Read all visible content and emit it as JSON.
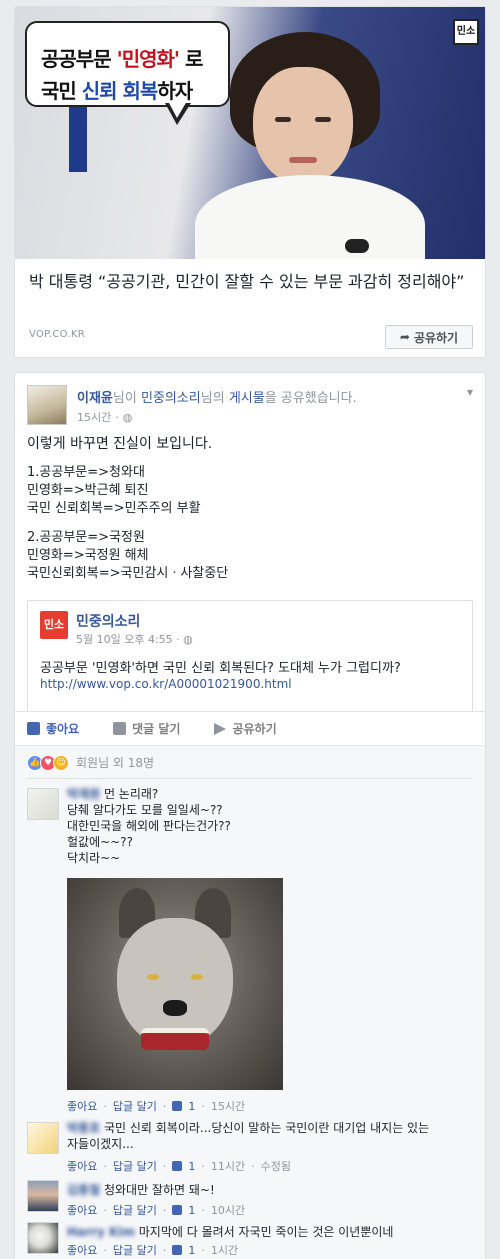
{
  "link_preview": {
    "image": {
      "bubble_line1_pre": "공공부문 ",
      "bubble_line1_hl": "'민영화'",
      "bubble_line1_post": " 로",
      "bubble_line2_pre": "국민 ",
      "bubble_line2_hl": "신뢰 회복",
      "bubble_line2_post": "하자",
      "logo_text": "민소"
    },
    "title": "박 대통령 “공공기관, 민간이 잘할 수 있는 부문 과감히 정리해야”",
    "domain": "VOP.CO.KR",
    "share_label": "공유하기"
  },
  "post": {
    "author": "이재윤",
    "header_mid1": "님이 ",
    "shared_page": "민중의소리",
    "header_mid2": "님의 ",
    "shared_object": "게시물",
    "header_tail": "을 공유했습니다.",
    "time": "15시간",
    "lines": [
      "이렇게 바꾸면 진실이 보입니다.",
      "1.공공부문=>청와대",
      "민영화=>박근혜 퇴진",
      "국민 신뢰회복=>민주주의 부활",
      "2.공공부문=>국정원",
      "민영화=>국정원 해체",
      "국민신뢰회복=>국민감시ㆍ사찰중단"
    ],
    "embed": {
      "logo_text": "민소",
      "page_name": "민중의소리",
      "meta": "5월 10일 오후 4:55",
      "text": "공공부문 '민영화'하면 국민 신뢰 회복된다? 도대체 누가 그럽디까?",
      "url": "http://www.vop.co.kr/A00001021900.html"
    },
    "actions": {
      "like": "좋아요",
      "comment": "댓글 달기",
      "share": "공유하기"
    },
    "reactions_text": "회원님 외 18명"
  },
  "comments": [
    {
      "name": "박재원",
      "lines": [
        "먼 논리래?",
        "당췌 알다가도 모를 일일세~??",
        "대한민국을 해외에 판다는건가??",
        "헐값에~~??",
        "닥치라~~"
      ],
      "like": "좋아요",
      "reply": "답글 달기",
      "likes": "1",
      "time": "15시간",
      "extra": ""
    },
    {
      "name": "박종호",
      "lines": [
        "국민 신뢰 회복이라...당신이 말하는 국민이란 대기업 내지는 있는",
        "자들이겠지..."
      ],
      "like": "좋아요",
      "reply": "답글 달기",
      "likes": "1",
      "time": "11시간",
      "extra": "수정됨"
    },
    {
      "name": "김종철",
      "lines": [
        "청와대만 잘하면 돼~!"
      ],
      "like": "좋아요",
      "reply": "답글 달기",
      "likes": "1",
      "time": "10시간",
      "extra": ""
    },
    {
      "name": "Harry Kim",
      "lines": [
        "마지막에 다 몰려서 자국민 죽이는 것은 이년뿐이네"
      ],
      "like": "좋아요",
      "reply": "답글 달기",
      "likes": "1",
      "time": "1시간",
      "extra": ""
    }
  ]
}
